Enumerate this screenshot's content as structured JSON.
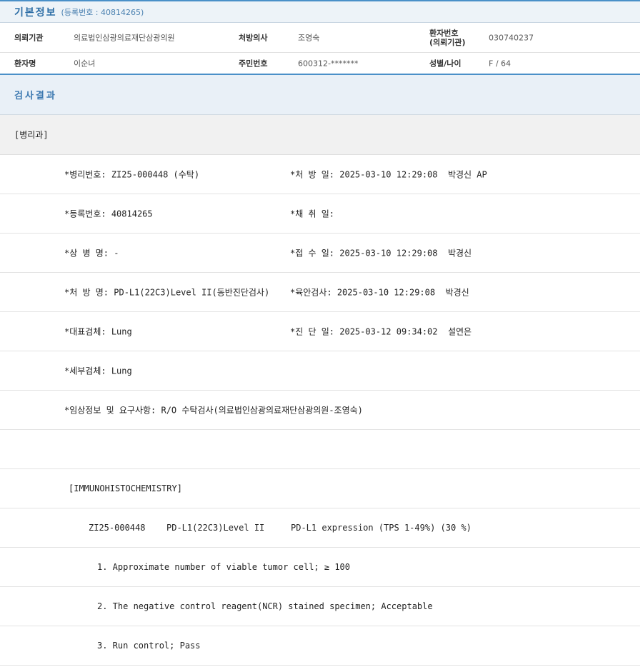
{
  "basic_info": {
    "title": "기본정보",
    "subtitle": "(등록번호 : 40814265)",
    "row1": {
      "inst_label": "의뢰기관",
      "inst_value": "의료법인삼광의료재단삼광의원",
      "doctor_label": "처방의사",
      "doctor_value": "조영숙",
      "patno_label_1": "환자번호",
      "patno_label_2": "(의뢰기관)",
      "patno_value": "030740237"
    },
    "row2": {
      "name_label": "환자명",
      "name_value": "이순녀",
      "ssn_label": "주민번호",
      "ssn_value": "600312-*******",
      "sexage_label": "성별/나이",
      "sexage_value": "F / 64"
    }
  },
  "results": {
    "title": "검사결과",
    "department": "[병리과]",
    "fields": {
      "pathology_no": "*병리번호: ZI25-000448 (수탁)",
      "order_date": "*처 방 일: 2025-03-10 12:29:08  박경신 AP",
      "reg_no": "*등록번호: 40814265",
      "collect_date": "*채 취 일:",
      "diagnosis": "*상 병 명: -",
      "receipt_date": "*접 수 일: 2025-03-10 12:29:08  박경신",
      "order_name": "*처 방 명: PD-L1(22C3)Level II(동반진단검사)",
      "gross_exam": "*육안검사: 2025-03-10 12:29:08  박경신",
      "main_specimen": "*대표검체: Lung",
      "diag_date": "*진 단 일: 2025-03-12 09:34:02  설연은",
      "sub_specimen": "*세부검체: Lung",
      "clinical_info": "*임상정보 및 요구사항: R/O 수탁검사(의료법인삼광의료재단삼광의원-조영숙)"
    },
    "ihc": {
      "header": "[IMMUNOHISTOCHEMISTRY]",
      "case_no": "ZI25-000448",
      "test": "PD-L1(22C3)Level II",
      "result": "PD-L1 expression (TPS 1-49%) (30 %)",
      "items": [
        "1. Approximate number of viable tumor cell; ≥ 100",
        "2. The negative control reagent(NCR) stained specimen; Acceptable",
        "3. Run control; Pass"
      ]
    }
  }
}
